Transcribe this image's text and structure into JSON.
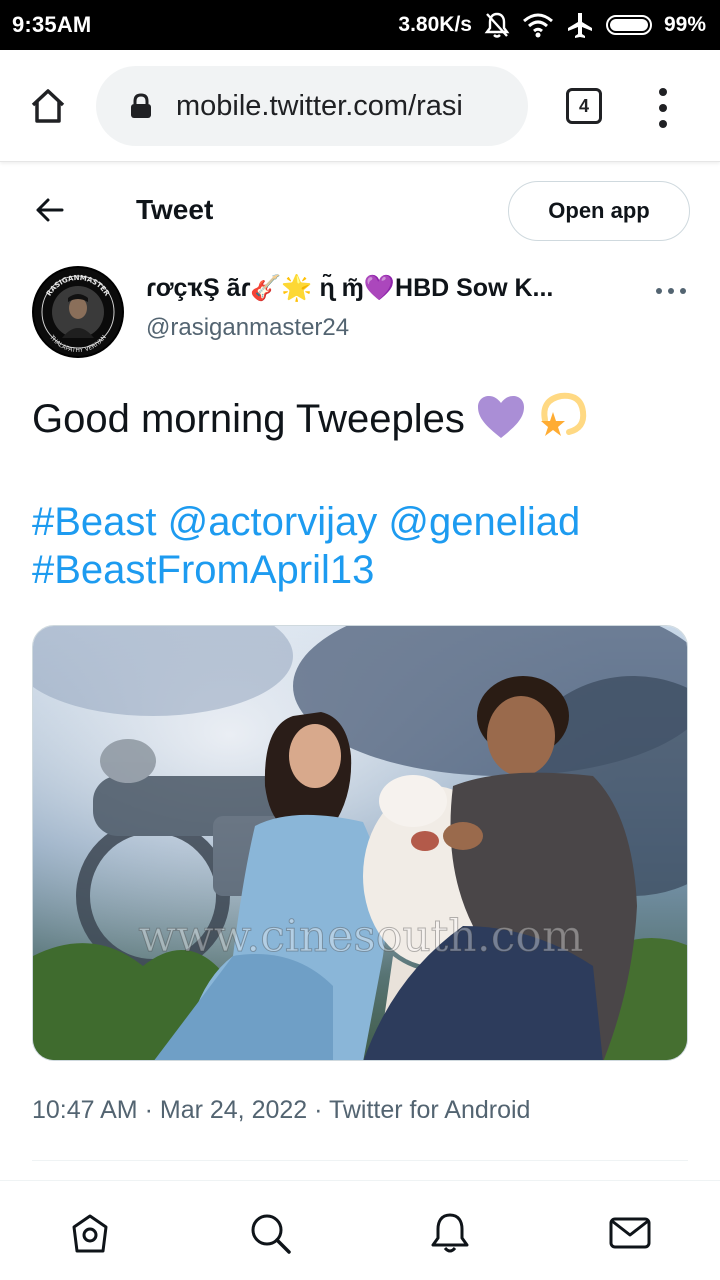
{
  "status_bar": {
    "time": "9:35AM",
    "network_speed": "3.80K/s",
    "battery": "99%",
    "battery_level": 0.99,
    "icons": [
      "mute-bell-icon",
      "wifi-icon",
      "airplane-icon",
      "battery-icon"
    ]
  },
  "browser": {
    "url": "mobile.twitter.com/rasi",
    "tab_count": "4"
  },
  "header": {
    "title": "Tweet",
    "open_app_label": "Open app"
  },
  "tweet": {
    "author": {
      "display_name": "ɾơçҡŞ ãɾ🎸🌟 ɳ̃ ɱ̃💜HBD Sow K...",
      "handle": "@rasiganmaster24",
      "avatar_text": [
        "RASIGANMASTER",
        "THALAPATHY VERIYAN"
      ]
    },
    "text": "Good morning Tweeples",
    "text_emojis": [
      "💜",
      "💫"
    ],
    "hashtags": [
      "#Beast",
      "@actorvijay",
      "@geneliad",
      "#BeastFromApril13"
    ],
    "image_watermark": "www.cinesouth.com",
    "time": "10:47 AM",
    "date": "Mar 24, 2022",
    "source": "Twitter for Android",
    "separator": "·"
  },
  "colors": {
    "link": "#1d9bf0",
    "text_primary": "#0f1419",
    "text_secondary": "#536471",
    "border": "#cfd9de"
  },
  "bottom_nav": {
    "items": [
      "home-icon",
      "search-icon",
      "notifications-icon",
      "messages-icon"
    ]
  }
}
